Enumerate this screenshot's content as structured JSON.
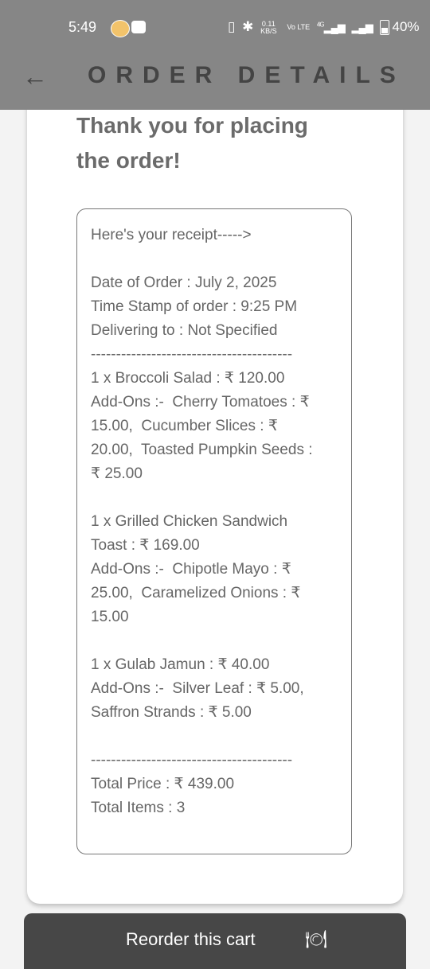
{
  "status_bar": {
    "time": "5:49",
    "netspeed_value": "0.11",
    "netspeed_unit": "KB/S",
    "volte": "Vo LTE",
    "network": "4G",
    "battery": "40%"
  },
  "header": {
    "title": "ORDER DETAILS",
    "back_icon": "arrow-left-icon"
  },
  "thank_you": "Thank you for placing the order!",
  "receipt_lines": [
    "Here's your receipt----->",
    "",
    "Date of Order : July 2, 2025",
    "Time Stamp of order : 9:25 PM",
    "Delivering to : Not Specified",
    "----------------------------------------",
    "1 x Broccoli Salad : ₹ 120.00",
    "Add-Ons :-  Cherry Tomatoes : ₹",
    "15.00,  Cucumber Slices : ₹",
    "20.00,  Toasted Pumpkin Seeds :",
    "₹ 25.00",
    "",
    "1 x Grilled Chicken Sandwich",
    "Toast : ₹ 169.00",
    "Add-Ons :-  Chipotle Mayo : ₹",
    "25.00,  Caramelized Onions : ₹",
    "15.00",
    "",
    "1 x Gulab Jamun : ₹ 40.00",
    "Add-Ons :-  Silver Leaf : ₹ 5.00,",
    "Saffron Strands : ₹ 5.00",
    "",
    "----------------------------------------",
    "Total Price : ₹ 439.00",
    "Total Items : 3"
  ],
  "reorder_button": {
    "label": "Reorder this cart",
    "icon": "plate-cutlery-icon"
  }
}
